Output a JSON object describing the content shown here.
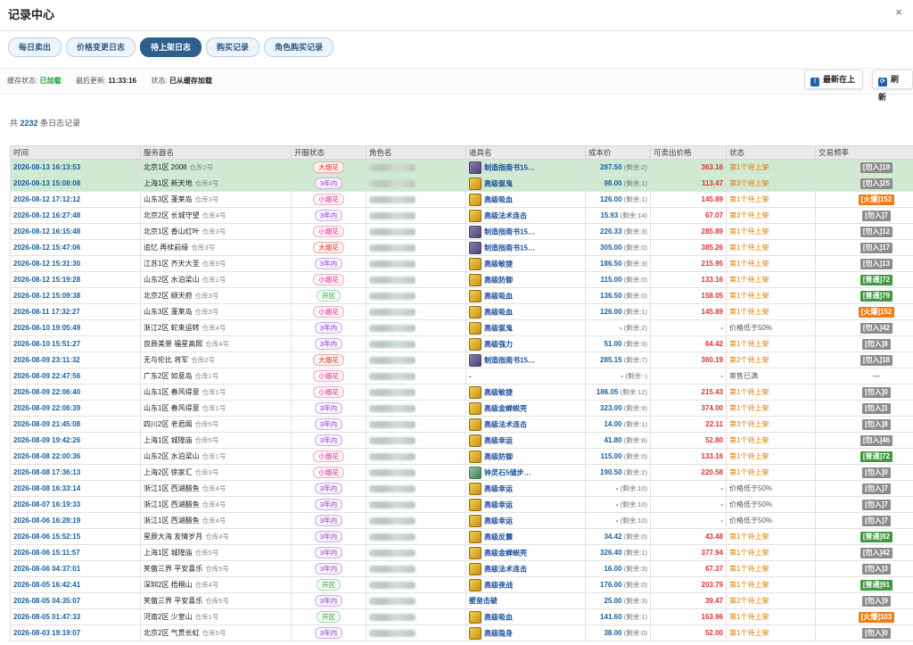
{
  "window": {
    "title": "记录中心",
    "close": "×"
  },
  "tabs": [
    {
      "label": "每日卖出",
      "active": false
    },
    {
      "label": "价格变更日志",
      "active": false
    },
    {
      "label": "待上架日志",
      "active": true
    },
    {
      "label": "购买记录",
      "active": false
    },
    {
      "label": "角色购买记录",
      "active": false
    }
  ],
  "status": {
    "cache_label": "缓存状态:",
    "cache_value": "已加载",
    "updated_label": "最后更新:",
    "updated_value": "11:33:16",
    "state_label": "状态:",
    "state_value": "已从缓存加载"
  },
  "buttons": {
    "latest": "最新在上",
    "refresh": "刷新"
  },
  "total": {
    "prefix": "共",
    "count": "2232",
    "suffix": "条日志记录"
  },
  "columns": [
    "时间",
    "服务器名",
    "开服状态",
    "角色名",
    "道具名",
    "成本价",
    "可卖出价格",
    "状态",
    "交易频率"
  ],
  "rows": [
    {
      "time": "2026-08-13 16:13:53",
      "server": "北京1区 2008",
      "wh": "仓库2号",
      "age": "大烟花",
      "age_c": "red",
      "icon": "book",
      "item": "制造指南书15…",
      "cost": "287.50",
      "rem": "(剩余:2)",
      "sell": "363.16",
      "status": "第1个待上架",
      "st": "orange",
      "freq": "[勿入]19",
      "fc": "gray",
      "hl": true
    },
    {
      "time": "2026-08-13 15:08:08",
      "server": "上海1区 新天地",
      "wh": "仓库4号",
      "age": "3年内",
      "age_c": "purple",
      "icon": "gold",
      "item": "高级驱鬼",
      "cost": "98.00",
      "rem": "(剩余:1)",
      "sell": "113.47",
      "status": "第3个待上架",
      "st": "orange",
      "freq": "[勿入]25",
      "fc": "gray",
      "hl": true
    },
    {
      "time": "2026-08-12 17:12:12",
      "server": "山东3区 蓬莱岛",
      "wh": "仓库3号",
      "age": "小烟花",
      "age_c": "pink",
      "icon": "gold",
      "item": "高级吸血",
      "cost": "126.00",
      "rem": "(剩余:1)",
      "sell": "145.89",
      "status": "第1个待上架",
      "st": "orange",
      "freq": "[火爆]152",
      "fc": "orange",
      "hl": false
    },
    {
      "time": "2026-08-12 16:27:48",
      "server": "北京2区 长城守望",
      "wh": "仓库4号",
      "age": "3年内",
      "age_c": "purple",
      "icon": "gold",
      "item": "高级法术连击",
      "cost": "15.93",
      "rem": "(剩余:14)",
      "sell": "67.07",
      "status": "第3个待上架",
      "st": "orange",
      "freq": "[勿入]7",
      "fc": "gray",
      "hl": false
    },
    {
      "time": "2026-08-12 16:15:48",
      "server": "北京1区 香山红叶",
      "wh": "仓库3号",
      "age": "小烟花",
      "age_c": "pink",
      "icon": "book",
      "item": "制造指南书15…",
      "cost": "226.33",
      "rem": "(剩余:3)",
      "sell": "285.89",
      "status": "第1个待上架",
      "st": "orange",
      "freq": "[勿入]12",
      "fc": "gray",
      "hl": false
    },
    {
      "time": "2026-08-12 15:47:06",
      "server": "追忆 再续前缘",
      "wh": "仓库3号",
      "age": "大烟花",
      "age_c": "red",
      "icon": "book",
      "item": "制造指南书15…",
      "cost": "305.00",
      "rem": "(剩余:0)",
      "sell": "385.26",
      "status": "第1个待上架",
      "st": "orange",
      "freq": "[勿入]17",
      "fc": "gray",
      "hl": false
    },
    {
      "time": "2026-08-12 15:31:30",
      "server": "江苏1区 齐天大圣",
      "wh": "仓库5号",
      "age": "3年内",
      "age_c": "purple",
      "icon": "gold",
      "item": "高级敏捷",
      "cost": "186.50",
      "rem": "(剩余:3)",
      "sell": "215.95",
      "status": "第1个待上架",
      "st": "orange",
      "freq": "[勿入]13",
      "fc": "gray",
      "hl": false
    },
    {
      "time": "2026-08-12 15:19:28",
      "server": "山东2区 水泊梁山",
      "wh": "仓库1号",
      "age": "小烟花",
      "age_c": "pink",
      "icon": "gold",
      "item": "高级防御",
      "cost": "115.00",
      "rem": "(剩余:0)",
      "sell": "133.16",
      "status": "第1个待上架",
      "st": "orange",
      "freq": "[普通]72",
      "fc": "green",
      "hl": false
    },
    {
      "time": "2026-08-12 15:09:38",
      "server": "北京2区 顺天府",
      "wh": "仓库3号",
      "age": "开区",
      "age_c": "green",
      "icon": "gold",
      "item": "高级吸血",
      "cost": "136.50",
      "rem": "(剩余:0)",
      "sell": "158.05",
      "status": "第1个待上架",
      "st": "orange",
      "freq": "[普通]79",
      "fc": "green",
      "hl": false
    },
    {
      "time": "2026-08-11 17:32:27",
      "server": "山东3区 蓬莱岛",
      "wh": "仓库3号",
      "age": "小烟花",
      "age_c": "pink",
      "icon": "gold",
      "item": "高级吸血",
      "cost": "126.00",
      "rem": "(剩余:1)",
      "sell": "145.89",
      "status": "第1个待上架",
      "st": "orange",
      "freq": "[火爆]152",
      "fc": "orange",
      "hl": false
    },
    {
      "time": "2026-08-10 19:05:49",
      "server": "浙江2区 蛇来运转",
      "wh": "仓库4号",
      "age": "3年内",
      "age_c": "purple",
      "icon": "gold",
      "item": "高级驱鬼",
      "cost": "-",
      "rem": "(剩余:2)",
      "sell": "-",
      "status": "价格低于50%",
      "st": "gray",
      "freq": "[勿入]42",
      "fc": "gray",
      "hl": false
    },
    {
      "time": "2026-08-10 15:51:27",
      "server": "良辰美景 福星高照",
      "wh": "仓库4号",
      "age": "3年内",
      "age_c": "purple",
      "icon": "gold",
      "item": "高级强力",
      "cost": "51.00",
      "rem": "(剩余:3)",
      "sell": "64.42",
      "status": "第1个待上架",
      "st": "orange",
      "freq": "[勿入]8",
      "fc": "gray",
      "hl": false
    },
    {
      "time": "2026-08-09 23:11:32",
      "server": "无与伦比 将军",
      "wh": "仓库2号",
      "age": "大烟花",
      "age_c": "red",
      "icon": "book",
      "item": "制造指南书15…",
      "cost": "285.15",
      "rem": "(剩余:7)",
      "sell": "360.19",
      "status": "第2个待上架",
      "st": "orange",
      "freq": "[勿入]18",
      "fc": "gray",
      "hl": false
    },
    {
      "time": "2026-08-09 22:47:56",
      "server": "广东2区 如意岛",
      "wh": "仓库1号",
      "age": "小烟花",
      "age_c": "pink",
      "icon": "none",
      "item": "-",
      "cost": "-",
      "rem": "(剩余:-)",
      "sell": "-",
      "status": "寄售已满",
      "st": "gray",
      "freq": "—",
      "fc": "none",
      "hl": false
    },
    {
      "time": "2026-08-09 22:06:40",
      "server": "山东1区 春风得意",
      "wh": "仓库1号",
      "age": "小烟花",
      "age_c": "pink",
      "icon": "gold",
      "item": "高级敏捷",
      "cost": "186.05",
      "rem": "(剩余:12)",
      "sell": "215.43",
      "status": "第1个待上架",
      "st": "orange",
      "freq": "[勿入]0",
      "fc": "gray",
      "hl": false
    },
    {
      "time": "2026-08-09 22:06:39",
      "server": "山东1区 春风得意",
      "wh": "仓库1号",
      "age": "3年内",
      "age_c": "purple",
      "icon": "gold",
      "item": "高级金蝉蜕壳",
      "cost": "323.00",
      "rem": "(剩余:9)",
      "sell": "374.00",
      "status": "第1个待上架",
      "st": "orange",
      "freq": "[勿入]1",
      "fc": "gray",
      "hl": false
    },
    {
      "time": "2026-08-09 21:45:08",
      "server": "四川2区 老君阁",
      "wh": "仓库5号",
      "age": "3年内",
      "age_c": "purple",
      "icon": "gold",
      "item": "高级法术连击",
      "cost": "14.00",
      "rem": "(剩余:1)",
      "sell": "22.11",
      "status": "第3个待上架",
      "st": "orange",
      "freq": "[勿入]8",
      "fc": "gray",
      "hl": false
    },
    {
      "time": "2026-08-09 19:42:26",
      "server": "上海1区 城隍庙",
      "wh": "仓库5号",
      "age": "3年内",
      "age_c": "purple",
      "icon": "gold",
      "item": "高级幸运",
      "cost": "41.80",
      "rem": "(剩余:6)",
      "sell": "52.80",
      "status": "第1个待上架",
      "st": "orange",
      "freq": "[勿入]46",
      "fc": "gray",
      "hl": false
    },
    {
      "time": "2026-08-08 22:00:36",
      "server": "山东2区 水泊梁山",
      "wh": "仓库1号",
      "age": "小烟花",
      "age_c": "pink",
      "icon": "gold",
      "item": "高级防御",
      "cost": "115.00",
      "rem": "(剩余:0)",
      "sell": "133.16",
      "status": "第1个待上架",
      "st": "orange",
      "freq": "[普通]72",
      "fc": "green",
      "hl": false
    },
    {
      "time": "2026-08-08 17:36:13",
      "server": "上海2区 徐家汇",
      "wh": "仓库3号",
      "age": "小烟花",
      "age_c": "pink",
      "icon": "stone",
      "item": "钟灵石5储步…",
      "cost": "190.50",
      "rem": "(剩余:2)",
      "sell": "220.58",
      "status": "第1个待上架",
      "st": "orange",
      "freq": "[勿入]0",
      "fc": "gray",
      "hl": false
    },
    {
      "time": "2026-08-08 16:33:14",
      "server": "浙江1区 西湖醋鱼",
      "wh": "仓库4号",
      "age": "3年内",
      "age_c": "purple",
      "icon": "gold",
      "item": "高级幸运",
      "cost": "-",
      "rem": "(剩余:10)",
      "sell": "-",
      "status": "价格低于50%",
      "st": "gray",
      "freq": "[勿入]7",
      "fc": "gray",
      "hl": false
    },
    {
      "time": "2026-08-07 16:19:33",
      "server": "浙江1区 西湖醋鱼",
      "wh": "仓库4号",
      "age": "3年内",
      "age_c": "purple",
      "icon": "gold",
      "item": "高级幸运",
      "cost": "-",
      "rem": "(剩余:10)",
      "sell": "-",
      "status": "价格低于50%",
      "st": "gray",
      "freq": "[勿入]7",
      "fc": "gray",
      "hl": false
    },
    {
      "time": "2026-08-06 16:28:19",
      "server": "浙江1区 西湖醋鱼",
      "wh": "仓库4号",
      "age": "3年内",
      "age_c": "purple",
      "icon": "gold",
      "item": "高级幸运",
      "cost": "-",
      "rem": "(剩余:10)",
      "sell": "-",
      "status": "价格低于50%",
      "st": "gray",
      "freq": "[勿入]7",
      "fc": "gray",
      "hl": false
    },
    {
      "time": "2026-08-06 15:52:15",
      "server": "星辰大海 友情岁月",
      "wh": "仓库4号",
      "age": "3年内",
      "age_c": "purple",
      "icon": "gold",
      "item": "高级反震",
      "cost": "34.42",
      "rem": "(剩余:0)",
      "sell": "43.48",
      "status": "第1个待上架",
      "st": "orange",
      "freq": "[普通]82",
      "fc": "green",
      "hl": false
    },
    {
      "time": "2026-08-06 15:11:57",
      "server": "上海1区 城隍庙",
      "wh": "仓库5号",
      "age": "3年内",
      "age_c": "purple",
      "icon": "gold",
      "item": "高级金蝉蜕壳",
      "cost": "326.40",
      "rem": "(剩余:1)",
      "sell": "377.94",
      "status": "第1个待上架",
      "st": "orange",
      "freq": "[勿入]42",
      "fc": "gray",
      "hl": false
    },
    {
      "time": "2026-08-06 04:37:01",
      "server": "笑傲三界 平安喜乐",
      "wh": "仓库5号",
      "age": "3年内",
      "age_c": "purple",
      "icon": "gold",
      "item": "高级法术连击",
      "cost": "16.00",
      "rem": "(剩余:3)",
      "sell": "67.37",
      "status": "第1个待上架",
      "st": "orange",
      "freq": "[勿入]3",
      "fc": "gray",
      "hl": false
    },
    {
      "time": "2026-08-05 16:42:41",
      "server": "深圳2区 梧桐山",
      "wh": "仓库4号",
      "age": "开区",
      "age_c": "green",
      "icon": "gold",
      "item": "高级夜战",
      "cost": "176.00",
      "rem": "(剩余:0)",
      "sell": "203.79",
      "status": "第1个待上架",
      "st": "orange",
      "freq": "[普通]91",
      "fc": "green",
      "hl": false
    },
    {
      "time": "2026-08-05 04:35:07",
      "server": "笑傲三界 平安喜乐",
      "wh": "仓库5号",
      "age": "3年内",
      "age_c": "purple",
      "icon": "none",
      "item": "壁垒击破",
      "cost": "25.00",
      "rem": "(剩余:3)",
      "sell": "39.47",
      "status": "第2个待上架",
      "st": "orange",
      "freq": "[勿入]9",
      "fc": "gray",
      "hl": false
    },
    {
      "time": "2026-08-05 01:47:33",
      "server": "河南2区 少室山",
      "wh": "仓库1号",
      "age": "开区",
      "age_c": "green",
      "icon": "gold",
      "item": "高级吸血",
      "cost": "141.60",
      "rem": "(剩余:1)",
      "sell": "163.96",
      "status": "第1个待上架",
      "st": "orange",
      "freq": "[火爆]103",
      "fc": "orange",
      "hl": false
    },
    {
      "time": "2026-08-03 19:19:07",
      "server": "北京2区 气贯长虹",
      "wh": "仓库5号",
      "age": "3年内",
      "age_c": "purple",
      "icon": "gold",
      "item": "高级隐身",
      "cost": "38.00",
      "rem": "(剩余:0)",
      "sell": "52.00",
      "status": "第1个待上架",
      "st": "orange",
      "freq": "[勿入]0",
      "fc": "gray",
      "hl": false
    }
  ]
}
